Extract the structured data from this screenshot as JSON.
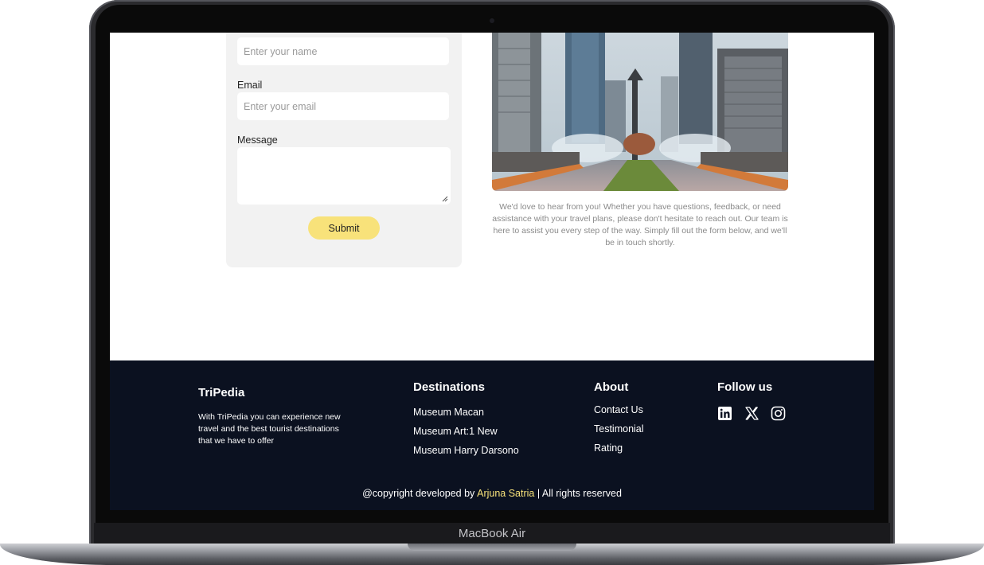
{
  "device": {
    "label": "MacBook Air"
  },
  "form": {
    "name_placeholder": "Enter your name",
    "email_label": "Email",
    "email_placeholder": "Enter your email",
    "message_label": "Message",
    "submit_label": "Submit"
  },
  "contact": {
    "text": "We'd love to hear from you! Whether you have questions, feedback, or need assistance with your travel plans, please don't hesitate to reach out. Our team is here to assist you every step of the way. Simply fill out the form below, and we'll be in touch shortly."
  },
  "footer": {
    "brand": "TriPedia",
    "brand_desc": "With TriPedia you can experience new travel and the best tourist destinations that we have to offer",
    "destinations": {
      "title": "Destinations",
      "items": [
        "Museum Macan",
        "Museum Art:1 New",
        "Museum Harry Darsono"
      ]
    },
    "about": {
      "title": "About",
      "items": [
        "Contact Us",
        "Testimonial",
        "Rating"
      ]
    },
    "follow": {
      "title": "Follow us",
      "icons": [
        "linkedin-icon",
        "x-icon",
        "instagram-icon"
      ]
    },
    "copyright": {
      "prefix": "@copyright developed by",
      "author": "Arjuna Satria",
      "suffix": "| All rights reserved"
    }
  },
  "colors": {
    "accent": "#f8e27a",
    "footer_bg": "#0b1120",
    "card_bg": "#f2f2f2"
  }
}
